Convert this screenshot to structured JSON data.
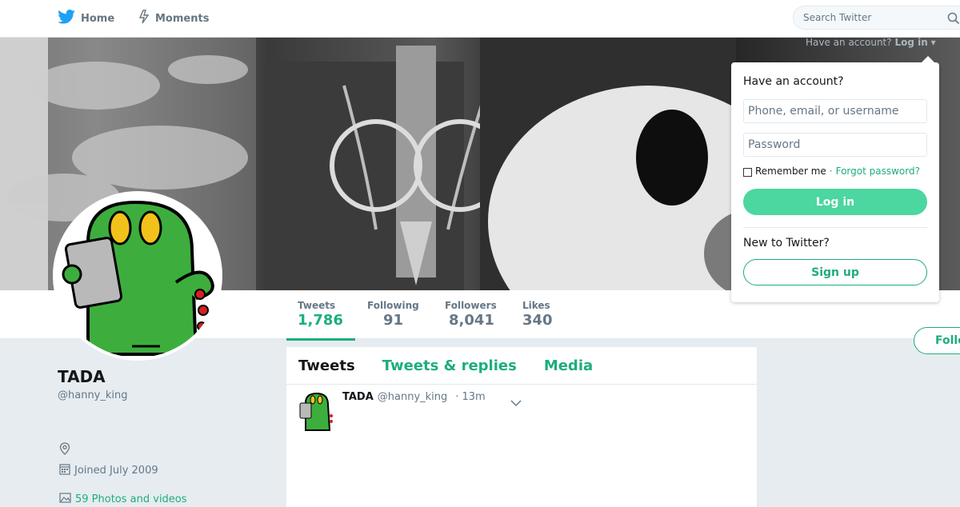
{
  "nav": {
    "home_label": "Home",
    "moments_label": "Moments",
    "search_placeholder": "Search Twitter"
  },
  "account_prompt": {
    "text": "Have an account?",
    "login_label": "Log in"
  },
  "profile": {
    "name": "TADA",
    "handle": "@hanny_king",
    "joined": "Joined July 2009",
    "photos": "59 Photos and videos"
  },
  "stats": {
    "tweets_label": "Tweets",
    "tweets_value": "1,786",
    "following_label": "Following",
    "following_value": "91",
    "followers_label": "Followers",
    "followers_value": "8,041",
    "likes_label": "Likes",
    "likes_value": "340"
  },
  "follow_button": "Follow",
  "timeline": {
    "tabs": [
      "Tweets",
      "Tweets & replies",
      "Media"
    ],
    "tweet": {
      "name": "TADA",
      "handle": "@hanny_king",
      "time": "13m"
    }
  },
  "login_panel": {
    "title": "Have an account?",
    "username_placeholder": "Phone, email, or username",
    "password_placeholder": "Password",
    "remember_label": "Remember me",
    "separator": "·",
    "forgot_label": "Forgot password?",
    "login_button": "Log in",
    "new_label": "New to Twitter?",
    "signup_button": "Sign up"
  },
  "colors": {
    "accent": "#1dad7e",
    "login_button": "#4cd6a0",
    "twitter_blue": "#1da1f2"
  }
}
